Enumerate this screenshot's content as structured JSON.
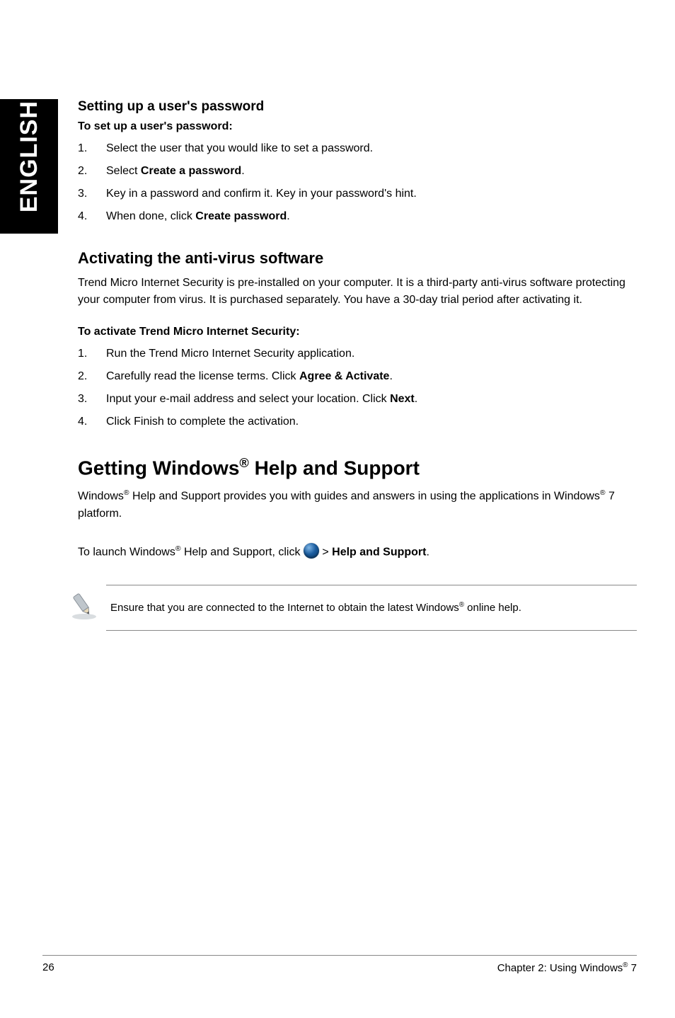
{
  "side_tab": "ENGLISH",
  "section_password": {
    "heading": "Setting up a user's password",
    "subheading": "To set up a user's password:",
    "steps": [
      {
        "num": "1.",
        "text_before": "Select the user that you would like to set a password.",
        "bold": "",
        "text_after": ""
      },
      {
        "num": "2.",
        "text_before": "Select ",
        "bold": "Create a password",
        "text_after": "."
      },
      {
        "num": "3.",
        "text_before": "Key in a password and confirm it. Key in your password's hint.",
        "bold": "",
        "text_after": ""
      },
      {
        "num": "4.",
        "text_before": "When done, click ",
        "bold": "Create password",
        "text_after": "."
      }
    ]
  },
  "section_antivirus": {
    "heading": "Activating the anti-virus software",
    "intro": "Trend Micro Internet Security is pre-installed on your computer. It is a third-party anti-virus software protecting your computer from virus. It is purchased separately. You have a 30-day trial period after activating it.",
    "subheading": "To activate Trend Micro Internet Security:",
    "steps": [
      {
        "num": "1.",
        "text_before": "Run the Trend Micro Internet Security application.",
        "bold": "",
        "text_after": ""
      },
      {
        "num": "2.",
        "text_before": "Carefully read the license terms. Click ",
        "bold": "Agree & Activate",
        "text_after": "."
      },
      {
        "num": "3.",
        "text_before": "Input your e-mail address and select your location. Click ",
        "bold": "Next",
        "text_after": "."
      },
      {
        "num": "4.",
        "text_before": "Click Finish to complete the activation.",
        "bold": "",
        "text_after": ""
      }
    ]
  },
  "section_help": {
    "heading_before": "Getting Windows",
    "heading_sup": "®",
    "heading_after": " Help and Support",
    "para1_before": "Windows",
    "para1_sup1": "®",
    "para1_mid": " Help and Support provides you with guides and answers in using the applications in Windows",
    "para1_sup2": "®",
    "para1_after": " 7 platform.",
    "launch_before": "To launch Windows",
    "launch_sup": "®",
    "launch_mid": " Help and Support, click ",
    "launch_gt": " > ",
    "launch_bold": "Help and Support",
    "launch_after": ".",
    "note_before": "Ensure that you are connected to the Internet to obtain the latest Windows",
    "note_sup": "®",
    "note_after": " online help."
  },
  "footer": {
    "page": "26",
    "chapter_before": "Chapter 2: Using Windows",
    "chapter_sup": "®",
    "chapter_after": " 7"
  },
  "icons": {
    "start_orb": "windows-start-orb-icon",
    "pencil": "note-pencil-icon"
  }
}
